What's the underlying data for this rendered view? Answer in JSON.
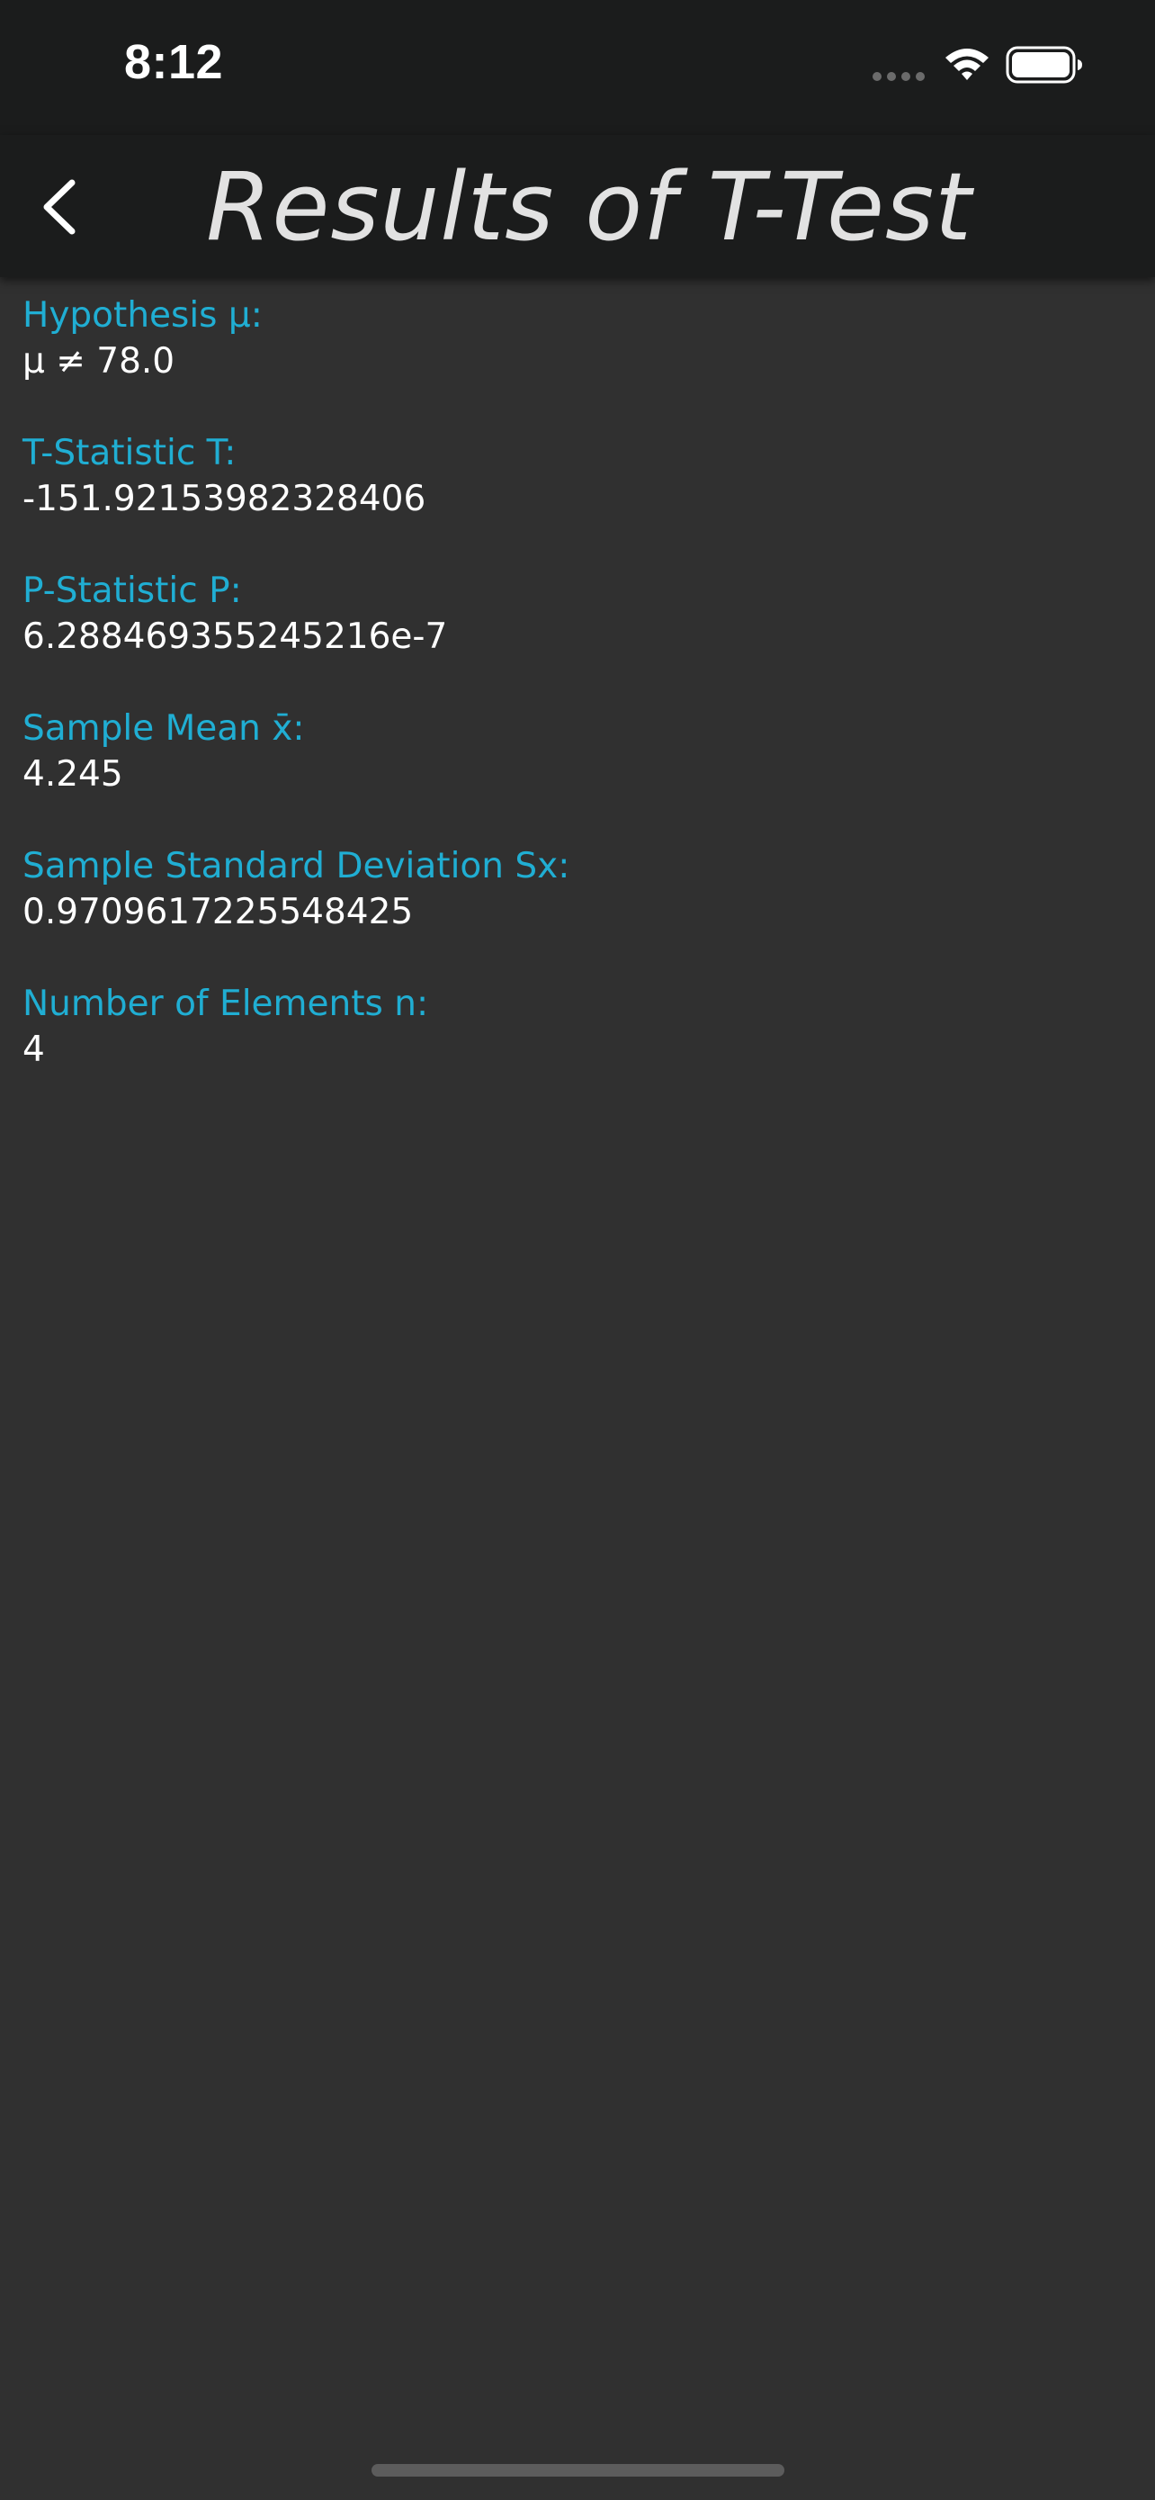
{
  "status_bar": {
    "time": "8:12",
    "icons": [
      "signal-icon",
      "wifi-icon",
      "battery-icon"
    ]
  },
  "nav": {
    "title": "Results of T-Test",
    "back_icon": "chevron-left-icon"
  },
  "results": [
    {
      "label": "Hypothesis μ:",
      "value": "μ ≠ 78.0"
    },
    {
      "label": "T-Statistic T:",
      "value": "-151.92153982328406"
    },
    {
      "label": "P-Statistic P:",
      "value": "6.288469355245216e-7"
    },
    {
      "label": "Sample Mean x̄:",
      "value": "4.245"
    },
    {
      "label": "Sample Standard Deviation Sx:",
      "value": "0.9709617225548425"
    },
    {
      "label": "Number of Elements n:",
      "value": "4"
    }
  ],
  "colors": {
    "background": "#303030",
    "bars": "#1b1c1c",
    "label": "#20aed3",
    "value": "#ffffff",
    "title": "#e2e2e2"
  }
}
